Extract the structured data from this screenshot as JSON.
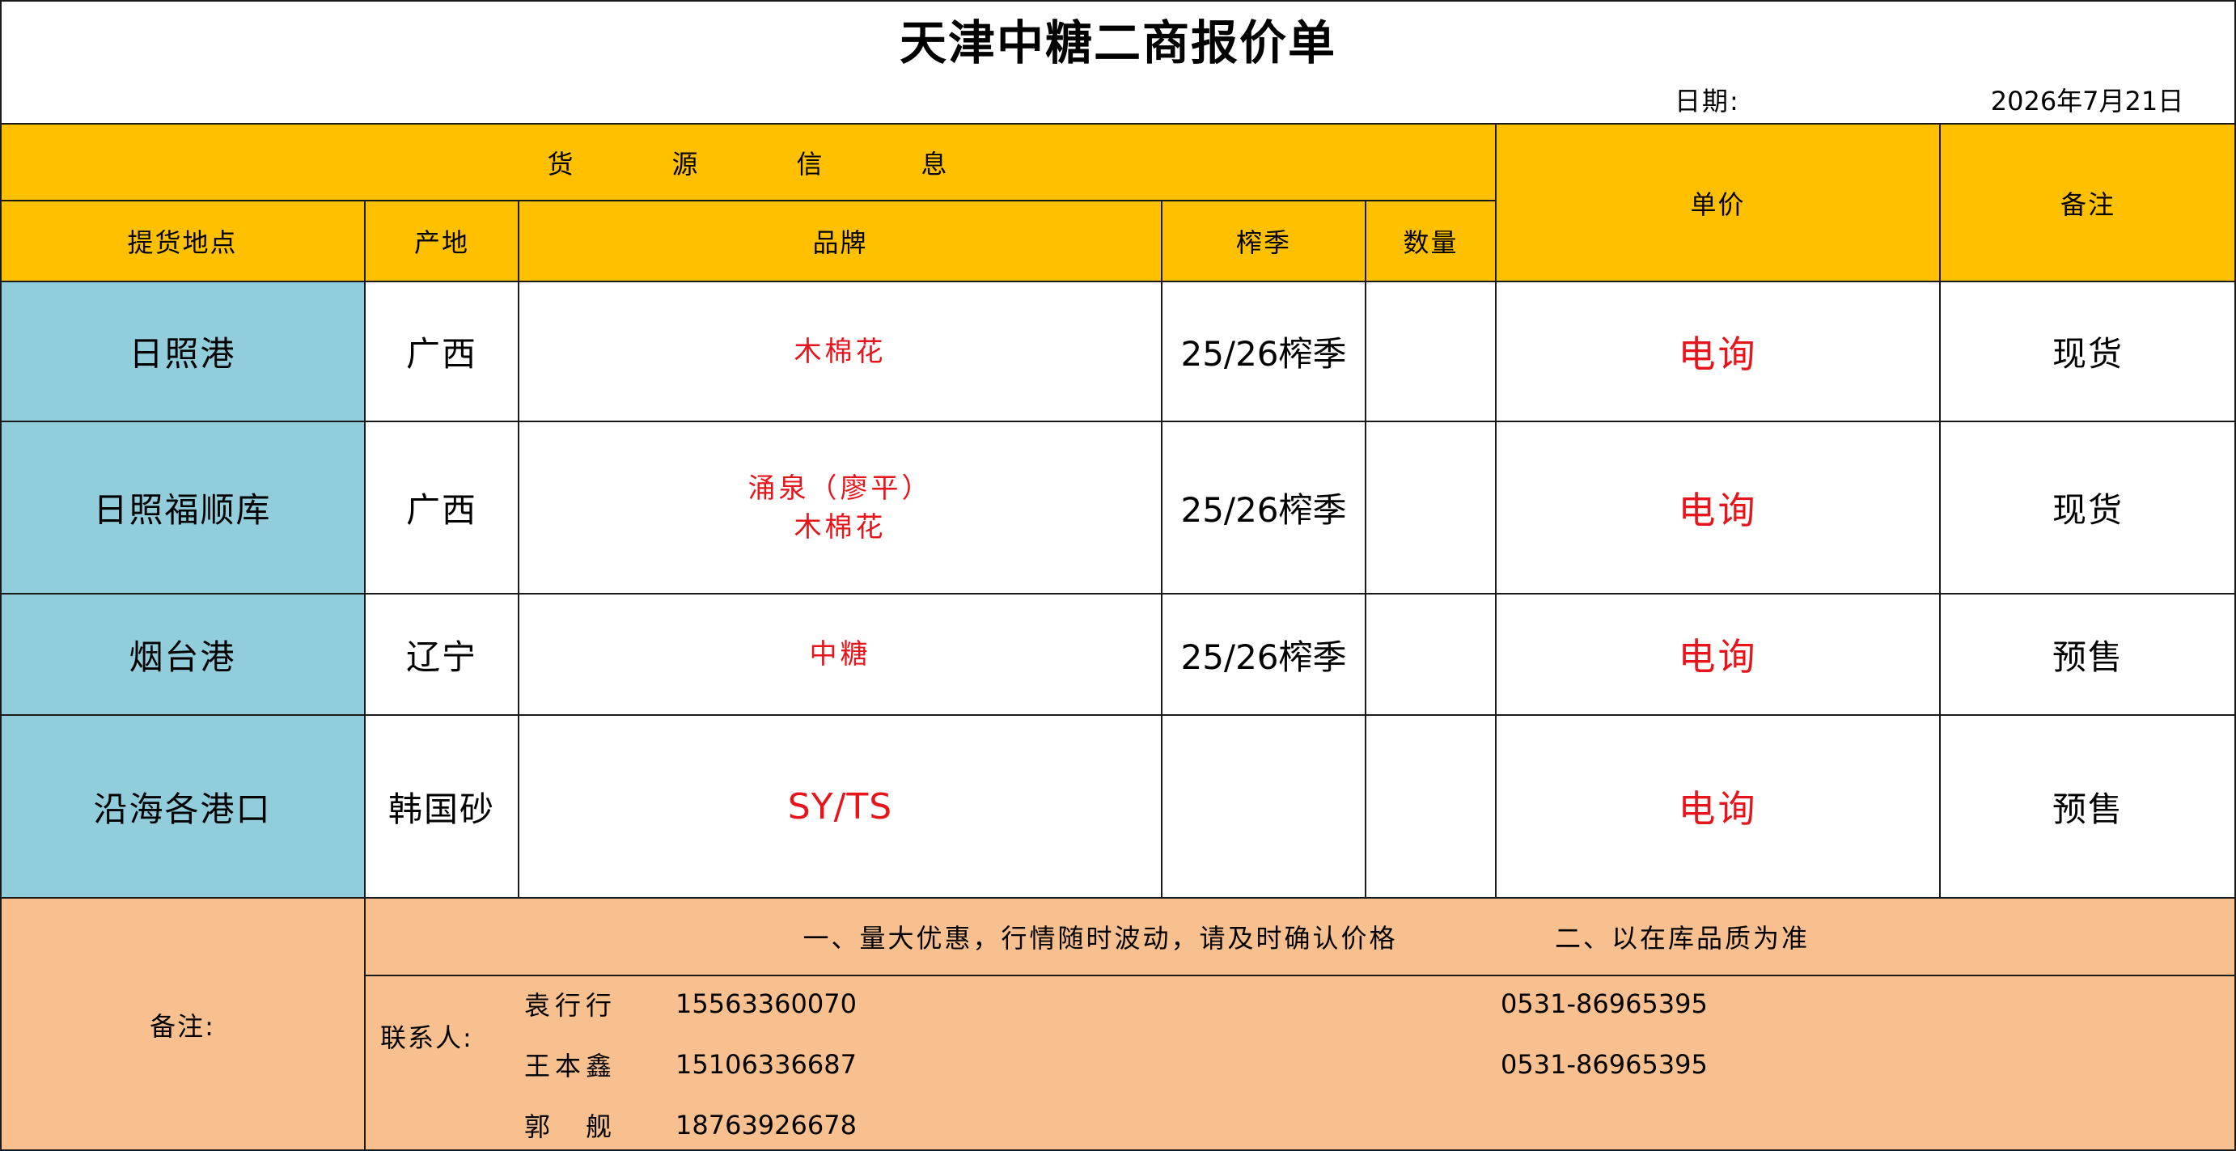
{
  "title": "天津中糖二商报价单",
  "date_label": "日期:",
  "date_value": "2026年7月21日",
  "header": {
    "source_info_chars": [
      "货",
      "源",
      "信",
      "息"
    ],
    "unit_price": "单价",
    "remark": "备注",
    "columns": [
      "提货地点",
      "产地",
      "品牌",
      "榨季",
      "数量"
    ]
  },
  "rows": [
    {
      "location": "日照港",
      "origin": "广西",
      "brand_lines": [
        "木棉花"
      ],
      "season": "25/26榨季",
      "quantity": "",
      "price": "电询",
      "remark": "现货"
    },
    {
      "location": "日照福顺库",
      "origin": "广西",
      "brand_lines": [
        "涌泉（廖平）",
        "木棉花"
      ],
      "season": "25/26榨季",
      "quantity": "",
      "price": "电询",
      "remark": "现货"
    },
    {
      "location": "烟台港",
      "origin": "辽宁",
      "brand_lines": [
        "中糖"
      ],
      "season": "25/26榨季",
      "quantity": "",
      "price": "电询",
      "remark": "预售"
    },
    {
      "location": "沿海各港口",
      "origin": "韩国砂",
      "brand_lines": [
        "SY/TS"
      ],
      "season": "",
      "quantity": "",
      "price": "电询",
      "remark": "预售"
    }
  ],
  "footer": {
    "remark_label": "备注:",
    "note1": "一、量大优惠，行情随时波动，请及时确认价格",
    "note2": "二、以在库品质为准",
    "contact_label": "联系人:",
    "contacts": [
      {
        "name": "袁行行",
        "mobile": "15563360070",
        "phone": "0531-86965395"
      },
      {
        "name": "王本鑫",
        "mobile": "15106336687",
        "phone": "0531-86965395"
      },
      {
        "name": "郭　舰",
        "mobile": "18763926678",
        "phone": ""
      }
    ]
  },
  "colors": {
    "header_bg": "#ffc000",
    "location_bg": "#92cddc",
    "footer_bg": "#f8bf8f",
    "highlight_text": "#e8141b"
  }
}
